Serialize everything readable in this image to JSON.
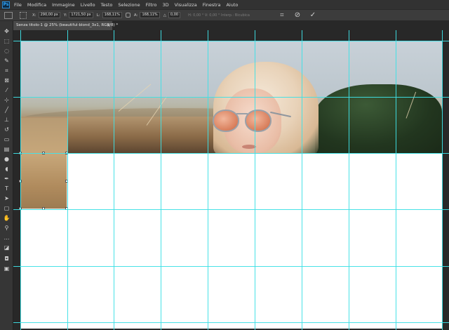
{
  "app": {
    "name": "Photoshop",
    "logo_text": "Ps"
  },
  "menubar": {
    "items": [
      "File",
      "Modifica",
      "Immagine",
      "Livello",
      "Testo",
      "Selezione",
      "Filtro",
      "3D",
      "Visualizza",
      "Finestra",
      "Aiuto"
    ]
  },
  "options_bar": {
    "x_label": "X:",
    "x_value": "290,00 px",
    "y_label": "Y:",
    "y_value": "1721,50 px",
    "w_label": "L:",
    "w_value": "168,11%",
    "h_label": "A:",
    "h_value": "168,11%",
    "angle_label": "△",
    "angle_value": "0,00",
    "angle_unit": "°",
    "interpolation_label": "H: 0,00 °  V: 0,00 °   Interp.: Bicubica",
    "warp_icon": "warp-icon",
    "cancel_icon": "cancel-icon",
    "commit_icon": "commit-icon"
  },
  "document_tab": {
    "title": "Senza titolo-1 @ 25% (beautiful-blond_3x1, RGB/8) *",
    "close": "×"
  },
  "toolbox": {
    "tools": [
      "move-tool",
      "marquee-tool",
      "lasso-tool",
      "quick-select-tool",
      "crop-tool",
      "frame-tool",
      "eyedropper-tool",
      "healing-brush-tool",
      "brush-tool",
      "clone-stamp-tool",
      "history-brush-tool",
      "eraser-tool",
      "gradient-tool",
      "blur-tool",
      "dodge-tool",
      "pen-tool",
      "type-tool",
      "path-select-tool",
      "rectangle-tool",
      "hand-tool",
      "zoom-tool",
      "edit-toolbar",
      "colors",
      "quick-mask",
      "screen-mode"
    ]
  },
  "colors": {
    "accent": "#31a8ff",
    "guide": "#3ee0e6",
    "canvas": "#ffffff",
    "pasteboard": "#282828"
  }
}
